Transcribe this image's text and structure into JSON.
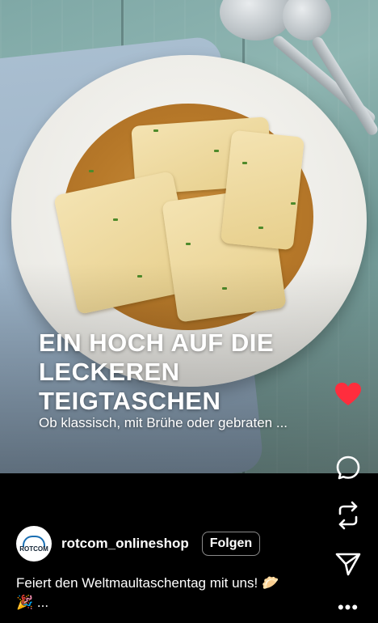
{
  "post": {
    "headline_lines": [
      "EIN HOCH AUF DIE",
      "LECKEREN",
      "TEIGTASCHEN"
    ],
    "subline": "Ob klassisch, mit Brühe oder gebraten ...",
    "image_alt": "Maultaschen in Brühe mit Schnittlauch"
  },
  "account": {
    "avatar_text": "ROTCOM",
    "username": "rotcom_onlineshop",
    "follow_label": "Folgen"
  },
  "caption": {
    "text": "Feiert den Weltmaultaschentag mit uns! 🥟",
    "more": "🎉 ..."
  },
  "actions": {
    "like_icon": "heart-icon",
    "comment_icon": "comment-icon",
    "share_icon": "repost-icon",
    "send_icon": "send-icon",
    "more_icon": "more-icon",
    "like_color": "#ff2d3d",
    "more_label": "•••"
  }
}
